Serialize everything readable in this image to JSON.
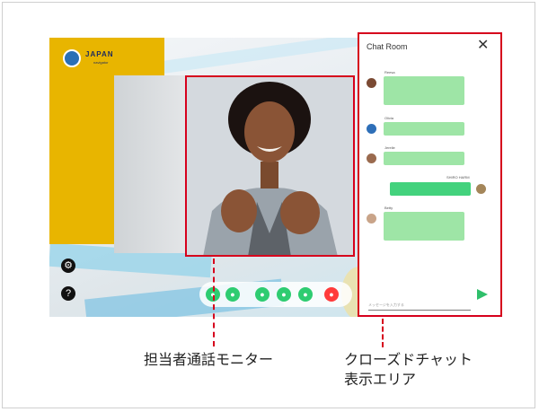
{
  "banner": {
    "brand": "JAPAN",
    "sub": "navigator"
  },
  "chat": {
    "title": "Chat Room",
    "close_glyph": "✕",
    "messages": [
      {
        "name": "Reesa"
      },
      {
        "name": "Olivia"
      },
      {
        "name": "Jerelle"
      },
      {
        "name": "SHIRO HARM",
        "mine": true
      },
      {
        "name": "Betty"
      }
    ],
    "input_placeholder": "メッセージを入力する",
    "send_glyph": "▶"
  },
  "sidebar": {
    "settings_glyph": "⚙",
    "help_glyph": "?"
  },
  "toolbar": {
    "colors": [
      "#2ecc71",
      "#2ecc71",
      "#2ecc71",
      "#2ecc71",
      "#2ecc71",
      "#ff3b3b"
    ]
  },
  "annotations": {
    "monitor_label": "担当者通話モニター",
    "chat_label_line1": "クローズドチャット",
    "chat_label_line2": "表示エリア"
  },
  "colors": {
    "highlight": "#d6001c",
    "bubble": "#9ee5a6",
    "bubble_mine": "#43d27d",
    "send": "#2fbf6b",
    "banner": "#e8b500"
  }
}
